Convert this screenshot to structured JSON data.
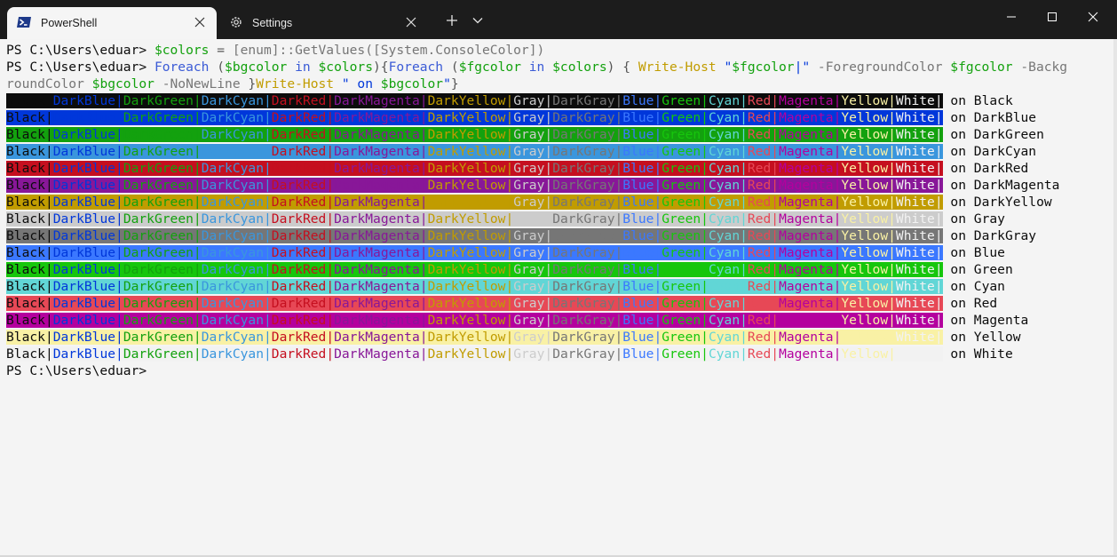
{
  "window": {
    "tabs": [
      {
        "label": "PowerShell",
        "icon": "powershell-icon",
        "active": true
      },
      {
        "label": "Settings",
        "icon": "gear-icon",
        "active": false
      }
    ],
    "controls": [
      "minimize-icon",
      "maximize-icon",
      "close-icon"
    ]
  },
  "terminal": {
    "prompt": "PS C:\\Users\\eduar>",
    "command_1": {
      "variable": "$colors",
      "operator": " = ",
      "type": "[enum]",
      "member": "::GetValues",
      "argument": "([System.ConsoleColor])"
    },
    "command_2": {
      "line_1": [
        {
          "text": "Foreach",
          "color": "#3b5bd6"
        },
        {
          "text": " (",
          "color": "#555555"
        },
        {
          "text": "$bgcolor",
          "color": "#13a10e"
        },
        {
          "text": " in ",
          "color": "#3b5bd6"
        },
        {
          "text": "$colors",
          "color": "#13a10e"
        },
        {
          "text": "){",
          "color": "#555555"
        },
        {
          "text": "Foreach",
          "color": "#3b5bd6"
        },
        {
          "text": " (",
          "color": "#555555"
        },
        {
          "text": "$fgcolor",
          "color": "#13a10e"
        },
        {
          "text": " in ",
          "color": "#3b5bd6"
        },
        {
          "text": "$colors",
          "color": "#13a10e"
        },
        {
          "text": ") { ",
          "color": "#555555"
        },
        {
          "text": "Write-Host",
          "color": "#c19c00"
        },
        {
          "text": " \"",
          "color": "#0037da"
        },
        {
          "text": "$fgcolor",
          "color": "#13a10e"
        },
        {
          "text": "|\"",
          "color": "#0037da"
        },
        {
          "text": " -ForegroundColor ",
          "color": "#767676"
        },
        {
          "text": "$fgcolor",
          "color": "#13a10e"
        },
        {
          "text": " -Backg",
          "color": "#767676"
        }
      ],
      "line_2": [
        {
          "text": "roundColor ",
          "color": "#767676"
        },
        {
          "text": "$bgcolor",
          "color": "#13a10e"
        },
        {
          "text": " -NoNewLine ",
          "color": "#767676"
        },
        {
          "text": "}",
          "color": "#555555"
        },
        {
          "text": "Write-Host",
          "color": "#c19c00"
        },
        {
          "text": " \" on ",
          "color": "#0037da"
        },
        {
          "text": "$bgcolor",
          "color": "#13a10e"
        },
        {
          "text": "\"",
          "color": "#0037da"
        },
        {
          "text": "}",
          "color": "#555555"
        }
      ]
    },
    "color_names": [
      "Black",
      "DarkBlue",
      "DarkGreen",
      "DarkCyan",
      "DarkRed",
      "DarkMagenta",
      "DarkYellow",
      "Gray",
      "DarkGray",
      "Blue",
      "Green",
      "Cyan",
      "Red",
      "Magenta",
      "Yellow",
      "White"
    ],
    "palette": [
      "#0c0c0c",
      "#0037da",
      "#13a10e",
      "#3a96dd",
      "#c50f1f",
      "#881798",
      "#c19c00",
      "#cccccc",
      "#767676",
      "#3b78ff",
      "#16c60c",
      "#61d6d6",
      "#e74856",
      "#b4009e",
      "#f9f1a5",
      "#f2f2f2"
    ],
    "separator": "|",
    "on_word": " on ",
    "prompt_after": "PS C:\\Users\\eduar>"
  }
}
